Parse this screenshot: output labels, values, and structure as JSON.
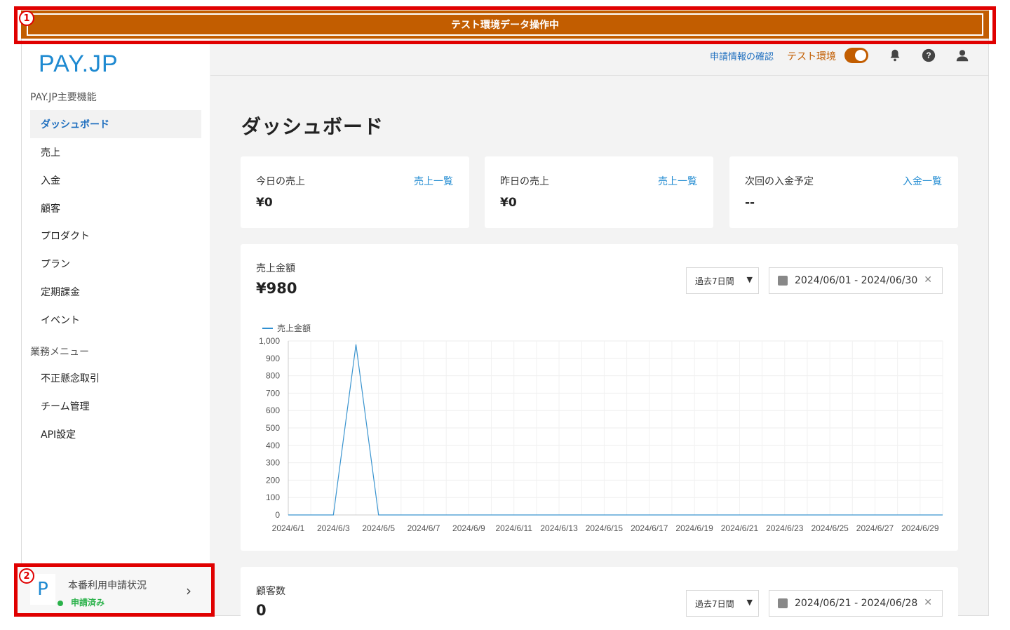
{
  "banner": {
    "text": "テスト環境データ操作中"
  },
  "annotations": {
    "one": "1",
    "two": "2"
  },
  "logo": "PAY.JP",
  "sidebar": {
    "section1": "PAY.JP主要機能",
    "items": [
      {
        "label": "ダッシュボード",
        "active": true
      },
      {
        "label": "売上"
      },
      {
        "label": "入金"
      },
      {
        "label": "顧客"
      },
      {
        "label": "プロダクト"
      },
      {
        "label": "プラン"
      },
      {
        "label": "定期課金"
      },
      {
        "label": "イベント"
      }
    ],
    "section2": "業務メニュー",
    "items2": [
      {
        "label": "不正懸念取引"
      },
      {
        "label": "チーム管理"
      },
      {
        "label": "API設定"
      }
    ],
    "status": {
      "logo": "P",
      "title": "本番利用申請状況",
      "state": "申請済み"
    }
  },
  "topbar": {
    "application_link": "申請情報の確認",
    "env_label": "テスト環境"
  },
  "page": {
    "title": "ダッシュボード"
  },
  "cards": [
    {
      "label": "今日の売上",
      "link": "売上一覧",
      "value": "¥0"
    },
    {
      "label": "昨日の売上",
      "link": "売上一覧",
      "value": "¥0"
    },
    {
      "label": "次回の入金予定",
      "link": "入金一覧",
      "value": "--"
    }
  ],
  "sales_panel": {
    "label": "売上金額",
    "total": "¥980",
    "period_select": "過去7日間",
    "date_range": "2024/06/01 - 2024/06/30"
  },
  "customers_panel": {
    "label": "顧客数",
    "total": "0",
    "period_select": "過去7日間",
    "date_range": "2024/06/21 - 2024/06/28"
  },
  "colors": {
    "accent": "#1f8ad1",
    "banner": "#c25d00",
    "success": "#2ab24a"
  },
  "chart_data": {
    "type": "line",
    "legend": "売上金額",
    "ylim": [
      0,
      1000
    ],
    "yticks": [
      "0",
      "100",
      "200",
      "300",
      "400",
      "500",
      "600",
      "700",
      "800",
      "900",
      "1,000"
    ],
    "x": [
      "2024/6/1",
      "2024/6/2",
      "2024/6/3",
      "2024/6/4",
      "2024/6/5",
      "2024/6/6",
      "2024/6/7",
      "2024/6/8",
      "2024/6/9",
      "2024/6/10",
      "2024/6/11",
      "2024/6/12",
      "2024/6/13",
      "2024/6/14",
      "2024/6/15",
      "2024/6/16",
      "2024/6/17",
      "2024/6/18",
      "2024/6/19",
      "2024/6/20",
      "2024/6/21",
      "2024/6/22",
      "2024/6/23",
      "2024/6/24",
      "2024/6/25",
      "2024/6/26",
      "2024/6/27",
      "2024/6/28",
      "2024/6/29",
      "2024/6/30"
    ],
    "xtick_labels": [
      "2024/6/1",
      "2024/6/3",
      "2024/6/5",
      "2024/6/7",
      "2024/6/9",
      "2024/6/11",
      "2024/6/13",
      "2024/6/15",
      "2024/6/17",
      "2024/6/19",
      "2024/6/21",
      "2024/6/23",
      "2024/6/25",
      "2024/6/27",
      "2024/6/29"
    ],
    "series": [
      {
        "name": "売上金額",
        "values": [
          0,
          0,
          0,
          980,
          0,
          0,
          0,
          0,
          0,
          0,
          0,
          0,
          0,
          0,
          0,
          0,
          0,
          0,
          0,
          0,
          0,
          0,
          0,
          0,
          0,
          0,
          0,
          0,
          0,
          0
        ]
      }
    ],
    "grid": true,
    "legend_position": "top-left"
  }
}
